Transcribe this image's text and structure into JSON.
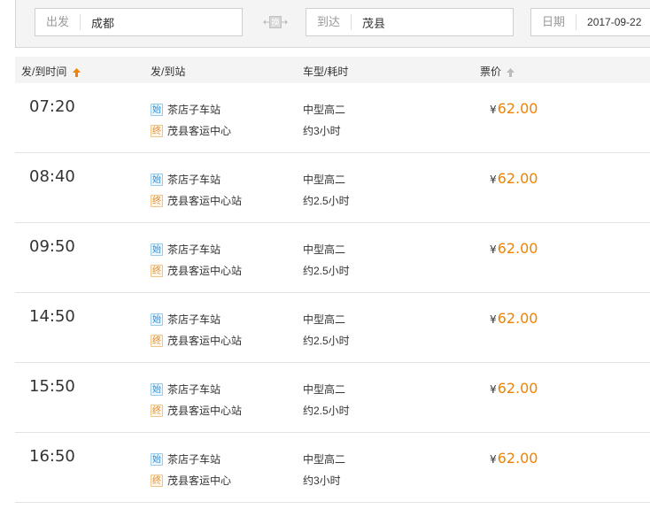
{
  "search": {
    "from_label": "出发",
    "from_value": "成都",
    "swap_label": "换",
    "to_label": "到达",
    "to_value": "茂县",
    "date_label": "日期",
    "date_value": "2017-09-22"
  },
  "table": {
    "headers": {
      "time": "发/到时间",
      "station": "发/到站",
      "type": "车型/耗时",
      "price": "票价"
    },
    "start_tag": "始",
    "end_tag": "终",
    "currency": "¥",
    "rows": [
      {
        "time": "07:20",
        "from": "茶店子车站",
        "to": "茂县客运中心",
        "bus_type": "中型高二",
        "duration": "约3小时",
        "price": "62.00"
      },
      {
        "time": "08:40",
        "from": "茶店子车站",
        "to": "茂县客运中心站",
        "bus_type": "中型高二",
        "duration": "约2.5小时",
        "price": "62.00"
      },
      {
        "time": "09:50",
        "from": "茶店子车站",
        "to": "茂县客运中心站",
        "bus_type": "中型高二",
        "duration": "约2.5小时",
        "price": "62.00"
      },
      {
        "time": "14:50",
        "from": "茶店子车站",
        "to": "茂县客运中心站",
        "bus_type": "中型高二",
        "duration": "约2.5小时",
        "price": "62.00"
      },
      {
        "time": "15:50",
        "from": "茶店子车站",
        "to": "茂县客运中心站",
        "bus_type": "中型高二",
        "duration": "约2.5小时",
        "price": "62.00"
      },
      {
        "time": "16:50",
        "from": "茶店子车站",
        "to": "茂县客运中心",
        "bus_type": "中型高二",
        "duration": "约3小时",
        "price": "62.00"
      }
    ]
  },
  "colors": {
    "accent_price": "#f08200",
    "start_tag": "#2b8fd6",
    "end_tag": "#e08c2a",
    "sort_active": "#f08200",
    "sort_inactive": "#bbbbbb"
  }
}
